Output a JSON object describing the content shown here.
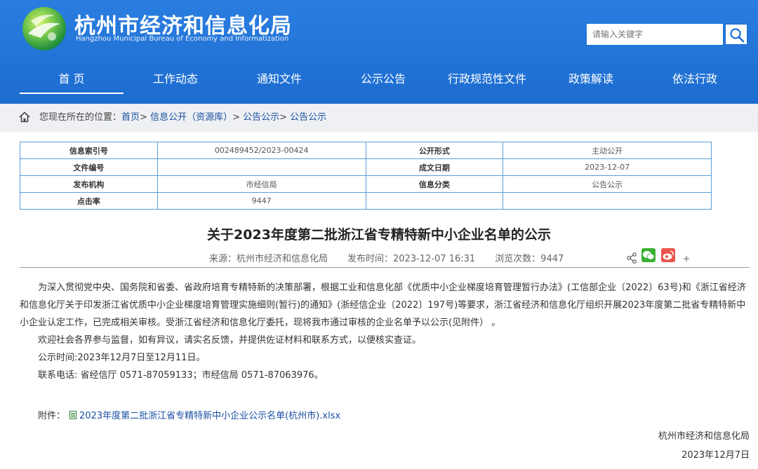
{
  "header": {
    "title": "杭州市经济和信息化局",
    "subtitle": "Hangzhou Municipal Bureau of Economy and Informatization",
    "search_placeholder": "请输入关键字"
  },
  "nav": [
    "首 页",
    "工作动态",
    "通知文件",
    "公示公告",
    "行政规范性文件",
    "政策解读",
    "依法行政"
  ],
  "breadcrumb": {
    "prefix": "您现在所在的位置：",
    "items": [
      "首页",
      "信息公开（资源库）",
      "公告公示",
      "公告公示"
    ],
    "sep": "> "
  },
  "info": {
    "rows": [
      {
        "k1": "信息索引号",
        "v1": "002489452/2023-00424",
        "k2": "公开形式",
        "v2": "主动公开"
      },
      {
        "k1": "文件编号",
        "v1": "",
        "k2": "成文日期",
        "v2": "2023-12-07"
      },
      {
        "k1": "发布机构",
        "v1": "市经信局",
        "k2": "信息分类",
        "v2": "公告公示"
      },
      {
        "k1": "点击率",
        "v1": "9447",
        "k2": "",
        "v2": ""
      }
    ]
  },
  "article": {
    "title": "关于2023年度第二批浙江省专精特新中小企业名单的公示",
    "source": "来源：杭州市经济和信息化局",
    "time": "发布时间：2023-12-07 16:31",
    "views": "浏览次数：9447",
    "para1": "为深入贯彻党中央、国务院和省委、省政府培育专精特新的决策部署，根据工业和信息化部《优质中小企业梯度培育管理暂行办法》(工信部企业〔2022〕63号)和《浙江省经济和信息化厅关于印发浙江省优质中小企业梯度培育管理实施细则(暂行)的通知》(浙经信企业〔2022〕197号)等要求，浙江省经济和信息化厅组织开展2023年度第二批省专精特新中小企业认定工作，已完成相关审核。受浙江省经济和信息化厅委托，现将我市通过审核的企业名单予以公示(见附件） 。",
    "para2": "欢迎社会各界参与监督，如有异议，请实名反馈，并提供佐证材料和联系方式，以便核实查证。",
    "para3": "公示时间:2023年12月7日至12月11日。",
    "para4": "联系电话: 省经信厅 0571-87059133；市经信局 0571-87063976。",
    "attach_label": "附件：",
    "attach_file": "2023年度第二批浙江省专精特新中小企业公示名单(杭州市).xlsx",
    "sign_org": "杭州市经济和信息化局",
    "sign_date": "2023年12月7日"
  },
  "colors": {
    "header_blue": "#1f6fd0",
    "link_blue": "#1a4fa3",
    "table_border": "#5a9bd8"
  },
  "icons": [
    "logo-emblem",
    "search-icon",
    "home-icon",
    "share-icon",
    "wechat-icon",
    "weibo-icon",
    "plus-icon",
    "excel-file-icon"
  ]
}
